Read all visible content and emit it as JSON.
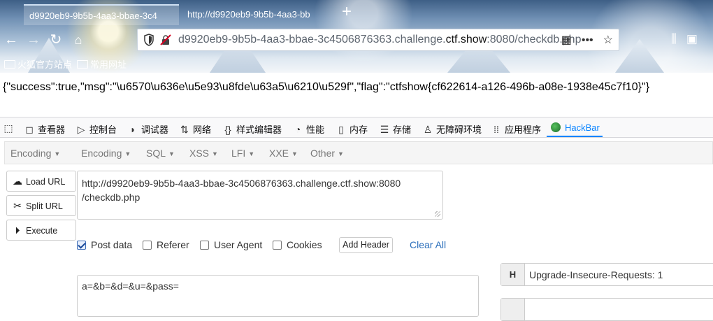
{
  "browser": {
    "tabs": [
      {
        "title": "d9920eb9-9b5b-4aa3-bbae-3c4",
        "active": true
      },
      {
        "title": "http://d9920eb9-9b5b-4aa3-bb",
        "active": false
      }
    ],
    "url": {
      "prefix": "d9920eb9-9b5b-4aa3-bbae-3c4506876363.challenge.",
      "domain": "ctf.show",
      "suffix": ":8080/checkdb.php"
    },
    "bookmarks": [
      "火狐官方站点",
      "常用网址"
    ]
  },
  "page": {
    "response": "{\"success\":true,\"msg\":\"\\u6570\\u636e\\u5e93\\u8fde\\u63a5\\u6210\\u529f\",\"flag\":\"ctfshow{cf622614-a126-496b-a08e-1938e45c7f10}\"}"
  },
  "devtools": {
    "tabs": [
      {
        "label": "查看器",
        "icon": "inspector-icon"
      },
      {
        "label": "控制台",
        "icon": "console-icon"
      },
      {
        "label": "调试器",
        "icon": "debugger-icon"
      },
      {
        "label": "网络",
        "icon": "network-icon"
      },
      {
        "label": "样式编辑器",
        "icon": "style-editor-icon"
      },
      {
        "label": "性能",
        "icon": "performance-icon"
      },
      {
        "label": "内存",
        "icon": "memory-icon"
      },
      {
        "label": "存储",
        "icon": "storage-icon"
      },
      {
        "label": "无障碍环境",
        "icon": "accessibility-icon"
      },
      {
        "label": "应用程序",
        "icon": "application-icon"
      },
      {
        "label": "HackBar",
        "icon": "hackbar-icon",
        "selected": true
      }
    ]
  },
  "hackbar": {
    "menu": [
      "Encoding",
      "Encoding",
      "SQL",
      "XSS",
      "LFI",
      "XXE",
      "Other"
    ],
    "buttons": {
      "load": "Load URL",
      "split": "Split URL",
      "execute": "Execute"
    },
    "url_lines": [
      "http://d9920eb9-9b5b-4aa3-bbae-3c4506876363.challenge.ctf.show:8080",
      "/checkdb.php"
    ],
    "options": {
      "post_data": {
        "label": "Post data",
        "checked": true
      },
      "referer": {
        "label": "Referer",
        "checked": false
      },
      "user_agent": {
        "label": "User Agent",
        "checked": false
      },
      "cookies": {
        "label": "Cookies",
        "checked": false
      }
    },
    "add_header": "Add Header",
    "clear_all": "Clear All",
    "post_body": "a=&b=&d=&u=&pass=",
    "headers": [
      {
        "key": "H",
        "value": "Upgrade-Insecure-Requests: 1"
      }
    ]
  }
}
